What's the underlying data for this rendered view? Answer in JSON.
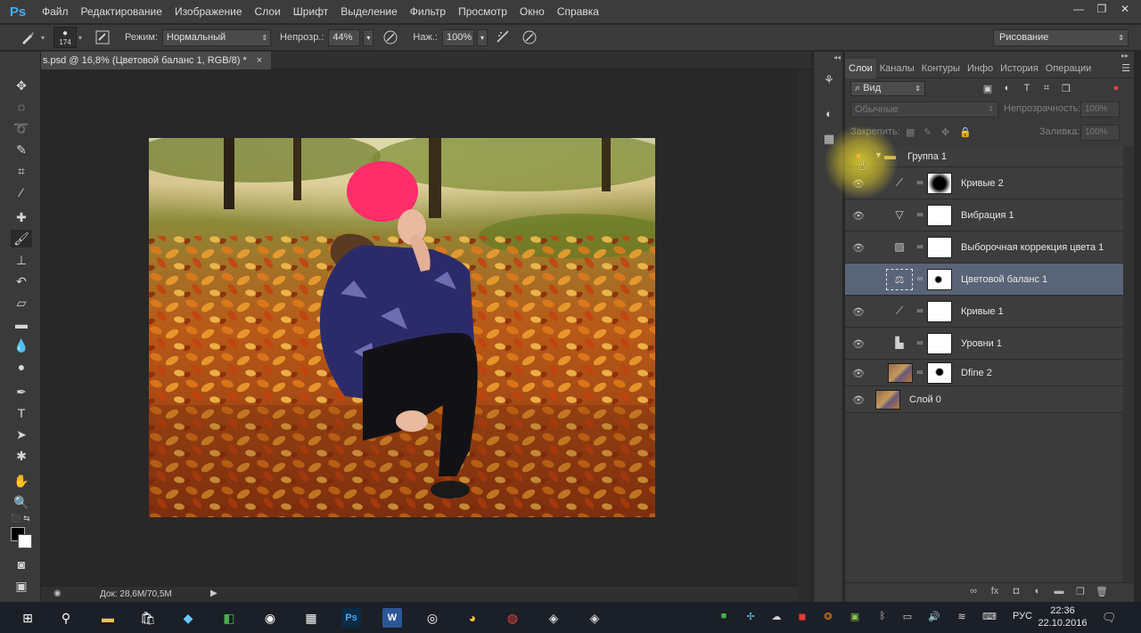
{
  "app": {
    "logo": "Ps"
  },
  "menu": [
    "Файл",
    "Редактирование",
    "Изображение",
    "Слои",
    "Шрифт",
    "Выделение",
    "Фильтр",
    "Просмотр",
    "Окно",
    "Справка"
  ],
  "window_controls": {
    "minimize": "—",
    "restore": "❐",
    "close": "✕"
  },
  "options_bar": {
    "brush_size": "174",
    "mode_label": "Режим:",
    "mode_value": "Нормальный",
    "opacity_label": "Непрозр.:",
    "opacity_value": "44%",
    "flow_label": "Наж.:",
    "flow_value": "100%",
    "workspace": "Рисование"
  },
  "document": {
    "tab_title": "s.psd @ 16,8% (Цветовой баланс 1, RGB/8) *",
    "close": "×",
    "status": "Док: 28,6M/70,5M"
  },
  "layers_panel": {
    "tabs": [
      "Слои",
      "Каналы",
      "Контуры",
      "Инфо",
      "История",
      "Операции"
    ],
    "filter": "Вид",
    "blend_mode": "Обычные",
    "opacity_label": "Непрозрачность:",
    "opacity_value": "100%",
    "lock_label": "Закрепить:",
    "fill_label": "Заливка:",
    "fill_value": "100%",
    "layers": [
      {
        "name": "Группа 1",
        "type": "group"
      },
      {
        "name": "Кривые 2",
        "type": "adjustment",
        "icon": "curves-icon"
      },
      {
        "name": "Вибрация 1",
        "type": "adjustment",
        "icon": "vibrance-icon"
      },
      {
        "name": "Выборочная коррекция цвета 1",
        "type": "adjustment",
        "icon": "selective-color-icon"
      },
      {
        "name": "Цветовой баланс 1",
        "type": "adjustment",
        "icon": "color-balance-icon",
        "selected": true
      },
      {
        "name": "Кривые 1",
        "type": "adjustment",
        "icon": "curves-icon"
      },
      {
        "name": "Уровни 1",
        "type": "adjustment",
        "icon": "levels-icon"
      },
      {
        "name": "Dfine 2",
        "type": "image"
      },
      {
        "name": "Слой 0",
        "type": "image"
      }
    ]
  },
  "taskbar": {
    "language": "РУС",
    "time": "22:36",
    "date": "22.10.2016"
  }
}
